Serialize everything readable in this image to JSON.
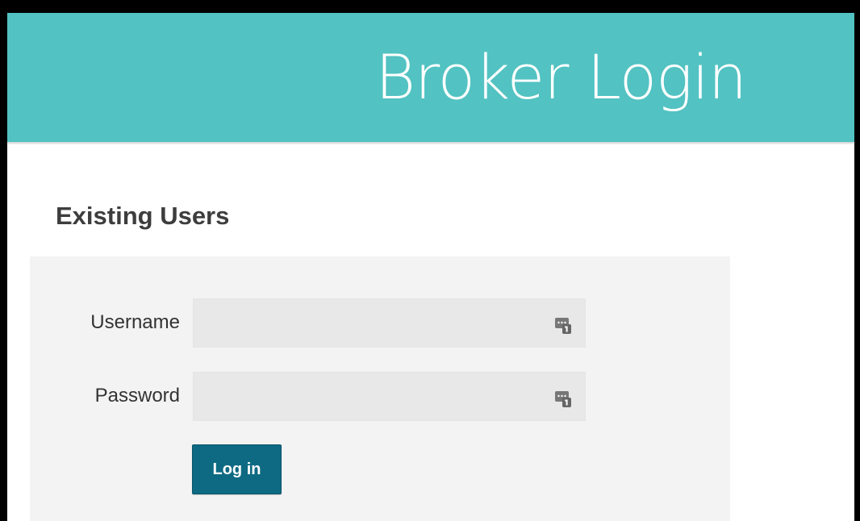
{
  "header": {
    "title": "Broker Login"
  },
  "login_section": {
    "title": "Existing Users",
    "username": {
      "label": "Username",
      "value": "",
      "icon": "password-manager-icon"
    },
    "password": {
      "label": "Password",
      "value": "",
      "icon": "password-manager-icon"
    },
    "submit_label": "Log in"
  },
  "colors": {
    "header_bg": "#52c2c2",
    "button_bg": "#0e6a83",
    "panel_bg": "#f3f3f3",
    "input_bg": "#e8e8e8"
  }
}
